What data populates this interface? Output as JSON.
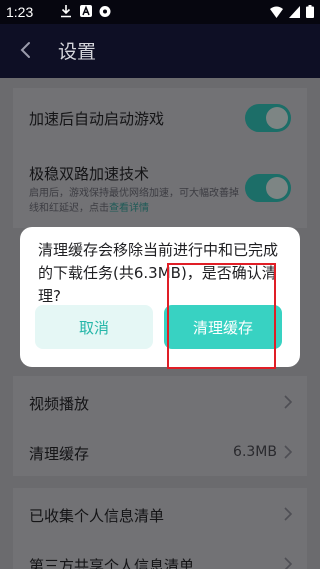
{
  "status_bar": {
    "time": "1:23",
    "left_icons": [
      "download-icon",
      "letter-a-icon",
      "settings-app-icon"
    ],
    "right_icons": [
      "wifi-icon",
      "signal-icon",
      "battery-icon"
    ]
  },
  "header": {
    "title": "设置",
    "back_icon": "back-arrow-icon"
  },
  "settings": {
    "auto_start": {
      "label": "加速后自动启动游戏",
      "enabled": true
    },
    "dual_channel": {
      "label": "极稳双路加速技术",
      "desc": "启用后，游戏保持最优网络加速，可大幅改善掉线和红延迟，点击",
      "link": "查看详情",
      "enabled": true
    },
    "video": {
      "label": "视频播放"
    },
    "clear_cache": {
      "label": "清理缓存",
      "value": "6.3MB"
    },
    "collected_info": {
      "label": "已收集个人信息清单"
    },
    "third_party": {
      "label": "第三方共享个人信息清单"
    }
  },
  "dialog": {
    "message": "清理缓存会移除当前进行中和已完成的下载任务(共6.3MB)，是否确认清理?",
    "cancel_label": "取消",
    "confirm_label": "清理缓存"
  },
  "colors": {
    "accent": "#38d2c2",
    "highlight_box": "#e01e26",
    "header_bg": "#0e0f25"
  }
}
